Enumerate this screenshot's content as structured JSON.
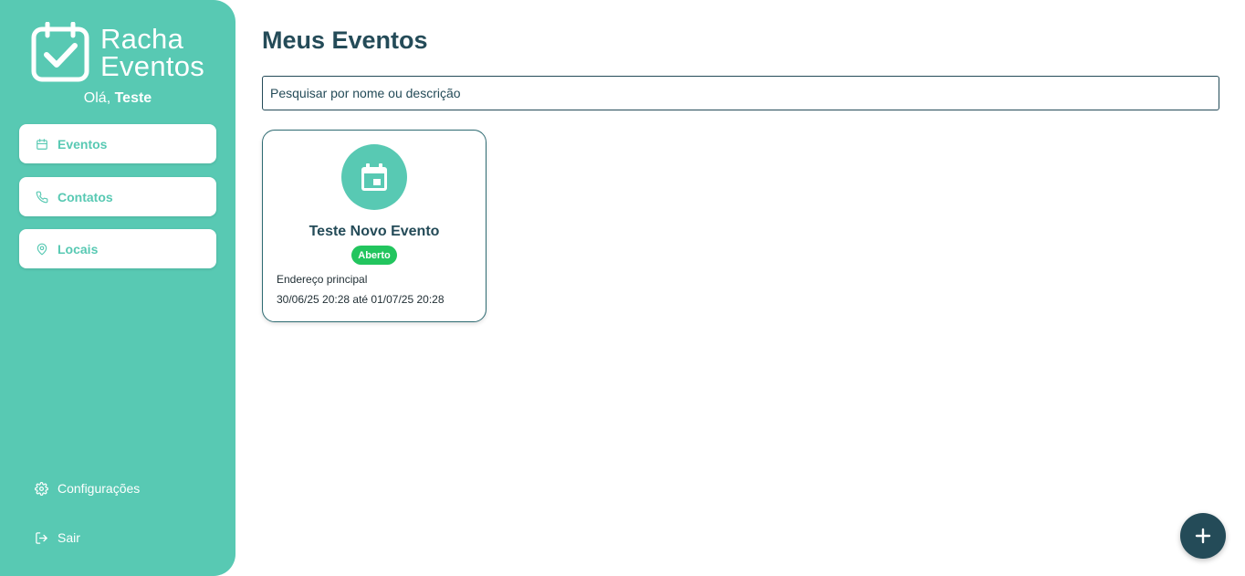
{
  "app": {
    "logo_line1": "Racha",
    "logo_line2": "Eventos",
    "greeting_prefix": "Olá,",
    "user_name": "Teste"
  },
  "sidebar": {
    "items": [
      {
        "label": "Eventos",
        "icon": "calendar-icon"
      },
      {
        "label": "Contatos",
        "icon": "phone-icon"
      },
      {
        "label": "Locais",
        "icon": "map-pin-icon"
      }
    ],
    "bottom": [
      {
        "label": "Configurações",
        "icon": "gear-icon"
      },
      {
        "label": "Sair",
        "icon": "logout-icon"
      }
    ]
  },
  "main": {
    "title": "Meus Eventos",
    "search_placeholder": "Pesquisar por nome ou descrição"
  },
  "events": [
    {
      "title": "Teste Novo Evento",
      "status": "Aberto",
      "address": "Endereço principal",
      "dates": "30/06/25 20:28 até 01/07/25 20:28",
      "icon": "calendar-icon"
    }
  ],
  "fab": {
    "icon": "plus-icon"
  },
  "colors": {
    "sidebar": "#58c9b3",
    "primary_dark": "#244b58",
    "badge_open": "#22c55e"
  }
}
